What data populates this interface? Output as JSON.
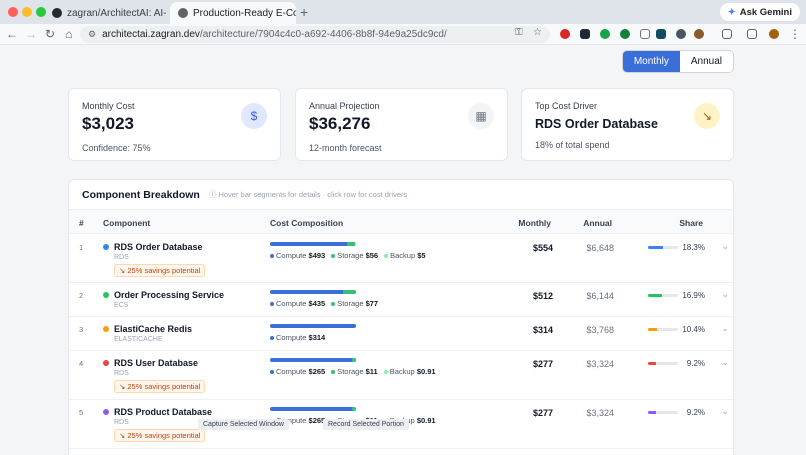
{
  "browser": {
    "tabs": [
      {
        "title": "zagran/ArchitectAI: AI-Powe",
        "active": false
      },
      {
        "title": "Production-Ready E-Commer",
        "active": true
      }
    ],
    "ask_gemini": "Ask Gemini",
    "url_host": "architectai.zagran.dev",
    "url_path": "/architecture/7904c4c0-a692-4406-8b8f-94e9a25dc9cd/"
  },
  "period_toggle": {
    "monthly": "Monthly",
    "annual": "Annual",
    "selected": "Monthly"
  },
  "cards": {
    "monthly_cost": {
      "label": "Monthly Cost",
      "value": "$3,023",
      "sub": "Confidence: 75%",
      "icon": "dollar-icon"
    },
    "annual_projection": {
      "label": "Annual Projection",
      "value": "$36,276",
      "sub": "12-month forecast",
      "icon": "calendar-icon"
    },
    "top_driver": {
      "label": "Top Cost Driver",
      "value": "RDS Order Database",
      "sub": "18% of total spend",
      "icon": "trending-down-icon"
    }
  },
  "breakdown": {
    "title": "Component Breakdown",
    "hint": "Hover bar segments for details · click row for cost drivers",
    "columns": {
      "num": "#",
      "component": "Component",
      "composition": "Cost Composition",
      "monthly": "Monthly",
      "annual": "Annual",
      "share": "Share"
    },
    "rows": [
      {
        "num": "1",
        "name": "RDS Order Database",
        "service": "RDS",
        "savings": "25% savings potential",
        "color": "#3b82f6",
        "parts": [
          {
            "label": "Compute",
            "value": "$493"
          },
          {
            "label": "Storage",
            "value": "$56"
          },
          {
            "label": "Backup",
            "value": "$5"
          }
        ],
        "fractions": [
          0.89,
          0.1,
          0.01
        ],
        "monthly": "$554",
        "annual": "$6,648",
        "share": "18.3%",
        "share_fraction": 0.183
      },
      {
        "num": "2",
        "name": "Order Processing Service",
        "service": "ECS",
        "savings": "",
        "color": "#22c55e",
        "parts": [
          {
            "label": "Compute",
            "value": "$435"
          },
          {
            "label": "Storage",
            "value": "$77"
          }
        ],
        "fractions": [
          0.85,
          0.15
        ],
        "monthly": "$512",
        "annual": "$6,144",
        "share": "16.9%",
        "share_fraction": 0.169
      },
      {
        "num": "3",
        "name": "ElastiCache Redis",
        "service": "ELASTICACHE",
        "savings": "",
        "color": "#f59e0b",
        "parts": [
          {
            "label": "Compute",
            "value": "$314"
          }
        ],
        "fractions": [
          1.0
        ],
        "monthly": "$314",
        "annual": "$3,768",
        "share": "10.4%",
        "share_fraction": 0.104
      },
      {
        "num": "4",
        "name": "RDS User Database",
        "service": "RDS",
        "savings": "25% savings potential",
        "color": "#ef4444",
        "parts": [
          {
            "label": "Compute",
            "value": "$265"
          },
          {
            "label": "Storage",
            "value": "$11"
          },
          {
            "label": "Backup",
            "value": "$0.91"
          }
        ],
        "fractions": [
          0.956,
          0.04,
          0.004
        ],
        "monthly": "$277",
        "annual": "$3,324",
        "share": "9.2%",
        "share_fraction": 0.092
      },
      {
        "num": "5",
        "name": "RDS Product Database",
        "service": "RDS",
        "savings": "25% savings potential",
        "color": "#8b5cf6",
        "parts": [
          {
            "label": "Compute",
            "value": "$265"
          },
          {
            "label": "Storage",
            "value": "$11"
          },
          {
            "label": "Backup",
            "value": "$0.91"
          }
        ],
        "fractions": [
          0.956,
          0.04,
          0.004
        ],
        "monthly": "$277",
        "annual": "$3,324",
        "share": "9.2%",
        "share_fraction": 0.092
      }
    ],
    "segment_colors": [
      "#3b6fd8",
      "#34c07a",
      "#86efac"
    ]
  },
  "tooltips": {
    "capture": "Capture Selected Window",
    "record": "Record Selected Portion"
  }
}
